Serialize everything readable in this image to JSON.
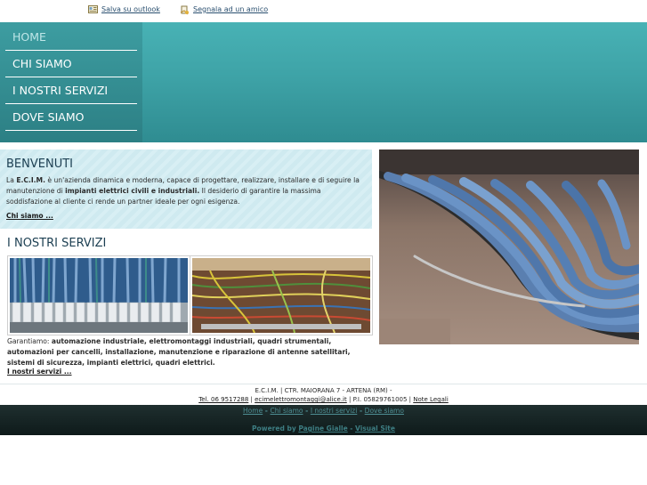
{
  "toplinks": {
    "outlook": "Salva su outlook",
    "friend": "Segnala ad un amico"
  },
  "nav": {
    "items": [
      "HOME",
      "CHI SIAMO",
      "I NOSTRI SERVIZI",
      "DOVE SIAMO"
    ]
  },
  "welcome": {
    "title": "BENVENUTI",
    "text_prefix": "La ",
    "company": "E.C.I.M.",
    "text_mid": " è un'azienda dinamica e moderna, capace di progettare, realizzare, installare e di seguire la manutenzione di ",
    "specialty": "impianti elettrici civili e industriali.",
    "text_end": " Il desiderio di garantire la massima soddisfazione al cliente ci rende un partner ideale per ogni esigenza.",
    "more": "Chi siamo ..."
  },
  "services": {
    "title": "I NOSTRI SERVIZI",
    "intro": "Garantiamo: ",
    "list": "automazione industriale, elettromontaggi industriali, quadri strumentali, automazioni per cancelli, installazione, manutenzione e riparazione di antenne satellitari, sistemi di sicurezza, impianti elettrici, quadri elettrici.",
    "more": "I nostri servizi ..."
  },
  "footer": {
    "address": "E.C.I.M. | CTR. MAIORANA 7 - ARTENA (RM) -",
    "tel": "Tel. 06 9517288",
    "email": "ecimelettromontaggi@alice.it",
    "piva": "P.I. 05829761005",
    "legal": "Note Legali"
  },
  "bottom": {
    "links": [
      "Home",
      "Chi siamo",
      "I nostri servizi",
      "Dove siamo"
    ],
    "powered_prefix": "Powered by ",
    "pagine": "Pagine Gialle",
    "visual": "Visual Site"
  },
  "colors": {
    "header": "#3ea3a7",
    "nav": "#2c7f84",
    "welcome_bg": "#cfeaf0",
    "bottom_bg": "#0e1a1a"
  },
  "icons": {
    "outlook": "outlook-card-icon",
    "friend": "send-friend-icon"
  }
}
